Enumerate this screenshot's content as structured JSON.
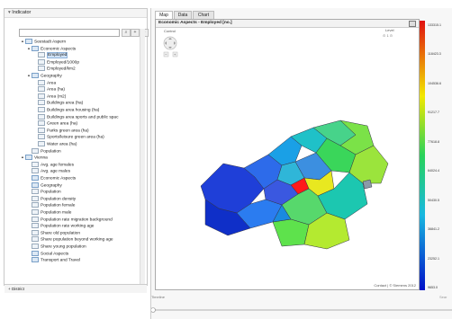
{
  "indicator_panel": {
    "title": "Indicator",
    "search": {
      "value": "",
      "placeholder": ""
    },
    "buttons": [
      "⌕",
      "+",
      "+"
    ],
    "tree": [
      {
        "label": "Seestadt Aspern",
        "level": 0,
        "toggle": "▲",
        "type": "folder"
      },
      {
        "label": "Economic Aspects",
        "level": 1,
        "toggle": "▲",
        "type": "folder"
      },
      {
        "label": "Employed",
        "level": 2,
        "toggle": "",
        "type": "leaf",
        "selected": true
      },
      {
        "label": "Employed/1000p",
        "level": 2,
        "toggle": "",
        "type": "leaf"
      },
      {
        "label": "Employed/km2",
        "level": 2,
        "toggle": "",
        "type": "leaf"
      },
      {
        "label": "Geography",
        "level": 1,
        "toggle": "▲",
        "type": "folder"
      },
      {
        "label": "Area",
        "level": 2,
        "toggle": "",
        "type": "leaf"
      },
      {
        "label": "Area (ha)",
        "level": 2,
        "toggle": "",
        "type": "leaf"
      },
      {
        "label": "Area (m2)",
        "level": 2,
        "toggle": "",
        "type": "leaf"
      },
      {
        "label": "Buildings area (ha)",
        "level": 2,
        "toggle": "",
        "type": "leaf"
      },
      {
        "label": "Buildings area housing (ha)",
        "level": 2,
        "toggle": "",
        "type": "leaf"
      },
      {
        "label": "Buildings area sports and public spac",
        "level": 2,
        "toggle": "",
        "type": "leaf"
      },
      {
        "label": "Green area (ha)",
        "level": 2,
        "toggle": "",
        "type": "leaf"
      },
      {
        "label": "Parks green area (ha)",
        "level": 2,
        "toggle": "",
        "type": "leaf"
      },
      {
        "label": "Sports/leisure green area (ha)",
        "level": 2,
        "toggle": "",
        "type": "leaf"
      },
      {
        "label": "Water area (ha)",
        "level": 2,
        "toggle": "",
        "type": "leaf"
      },
      {
        "label": "Population",
        "level": 1,
        "toggle": "",
        "type": "leaf"
      },
      {
        "label": "Vienna",
        "level": 0,
        "toggle": "▲",
        "type": "folder"
      },
      {
        "label": "Avg. age females",
        "level": 1,
        "toggle": "",
        "type": "leaf"
      },
      {
        "label": "Avg. age males",
        "level": 1,
        "toggle": "",
        "type": "leaf"
      },
      {
        "label": "Economic Aspects",
        "level": 1,
        "toggle": "",
        "type": "folder"
      },
      {
        "label": "Geography",
        "level": 1,
        "toggle": "",
        "type": "folder"
      },
      {
        "label": "Population",
        "level": 1,
        "toggle": "",
        "type": "leaf"
      },
      {
        "label": "Population density",
        "level": 1,
        "toggle": "",
        "type": "leaf"
      },
      {
        "label": "Population female",
        "level": 1,
        "toggle": "",
        "type": "leaf"
      },
      {
        "label": "Population male",
        "level": 1,
        "toggle": "",
        "type": "leaf"
      },
      {
        "label": "Population rate migration background",
        "level": 1,
        "toggle": "",
        "type": "leaf"
      },
      {
        "label": "Population rate working age",
        "level": 1,
        "toggle": "",
        "type": "leaf"
      },
      {
        "label": "Share old population",
        "level": 1,
        "toggle": "",
        "type": "leaf"
      },
      {
        "label": "Share population beyond working age",
        "level": 1,
        "toggle": "",
        "type": "leaf"
      },
      {
        "label": "Share young population",
        "level": 1,
        "toggle": "",
        "type": "leaf"
      },
      {
        "label": "Social Aspects",
        "level": 1,
        "toggle": "",
        "type": "folder"
      },
      {
        "label": "Transport and Travel",
        "level": 1,
        "toggle": "",
        "type": "folder"
      }
    ],
    "district_label": "District"
  },
  "tabs": [
    {
      "label": "Map",
      "active": true
    },
    {
      "label": "Data",
      "active": false
    },
    {
      "label": "Chart",
      "active": false
    }
  ],
  "map": {
    "title": "Economic Aspects - Employed [no.]",
    "control_label": "Control",
    "level_label": "Level",
    "level_options": "⊙ 1 ⊙",
    "contact": "Contact | © Siemens 2012",
    "region_colors": [
      "#1f3fd8",
      "#2d6bea",
      "#1aa0e6",
      "#1fc1c8",
      "#47d38a",
      "#7be248",
      "#3ad65a",
      "#9be43c",
      "#3c8fe0",
      "#2fb6d8",
      "#ff1a1a",
      "#e8e820",
      "#3a58e0",
      "#2b7cf0",
      "#57d86c",
      "#1cc7b0",
      "#8c9aa8",
      "#0f2fc8",
      "#5ee24c",
      "#b4ea30",
      "#1a8ae0"
    ]
  },
  "legend": {
    "ticks": [
      "133315.1",
      "118423.3",
      "104536.6",
      "91217.7",
      "77618.8",
      "64024.4",
      "50430.5",
      "36841.2",
      "23252.1",
      "9653.0"
    ],
    "colors": {
      "top": "#e01010",
      "mid_top": "#f2e800",
      "mid": "#28d25a",
      "mid_low": "#18b8e0",
      "bottom": "#0010c8"
    }
  },
  "timeline": {
    "label": "Timeline",
    "end_label": "Sear"
  }
}
